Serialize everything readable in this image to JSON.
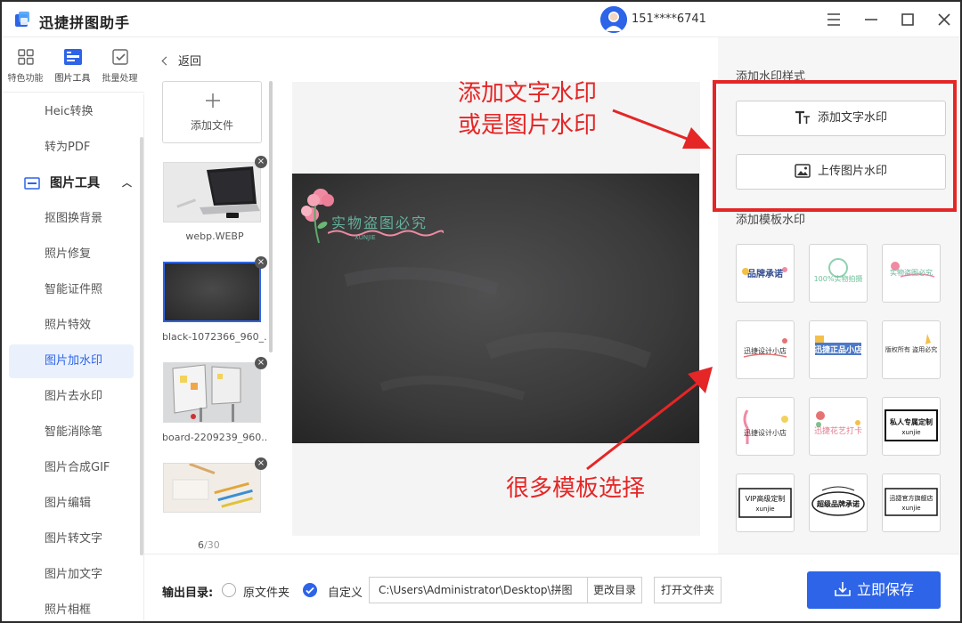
{
  "app": {
    "title": "迅捷拼图助手",
    "user_phone": "151****6741"
  },
  "top_tabs": [
    {
      "label": "特色功能",
      "icon": "grid-icon"
    },
    {
      "label": "图片工具",
      "icon": "image-tool-icon",
      "active": true
    },
    {
      "label": "批量处理",
      "icon": "batch-icon"
    }
  ],
  "sidebar": {
    "items_above": [
      "Heic转换",
      "转为PDF"
    ],
    "group": {
      "label": "图片工具"
    },
    "items": [
      "抠图换背景",
      "照片修复",
      "智能证件照",
      "照片特效",
      "图片加水印",
      "图片去水印",
      "智能消除笔",
      "图片合成GIF",
      "图片编辑",
      "图片转文字",
      "图片加文字",
      "照片相框"
    ],
    "active_item": "图片加水印"
  },
  "back_label": "返回",
  "files": {
    "add_label": "添加文件",
    "items": [
      {
        "name": "webp.WEBP"
      },
      {
        "name": "black-1072366_960_..."
      },
      {
        "name": "board-2209239_960..."
      }
    ],
    "page_current": "6",
    "page_total": "/30"
  },
  "preview": {
    "watermark_text": "实物盗图必究",
    "watermark_sub": "XUNJIE"
  },
  "right_panel": {
    "style_title": "添加水印样式",
    "add_text_label": "添加文字水印",
    "upload_image_label": "上传图片水印",
    "template_title": "添加模板水印",
    "templates": [
      {
        "text": "品牌承诺"
      },
      {
        "text": "100%实物拍摄"
      },
      {
        "text": "实物盗图必究"
      },
      {
        "text": "迅捷设计小店"
      },
      {
        "text": "迅捷正品小店"
      },
      {
        "text": "版权所有 盗用必究"
      },
      {
        "text": "迅捷设计小店"
      },
      {
        "text": "迅捷花艺打卡"
      },
      {
        "text": "私人专属定制",
        "sub": "xunjie"
      },
      {
        "text": "VIP高级定制",
        "sub": "xunjie"
      },
      {
        "text": "超级品牌承诺"
      },
      {
        "text": "迅捷官方旗舰店",
        "sub": "xunjie"
      }
    ]
  },
  "annotations": {
    "top_line1": "添加文字水印",
    "top_line2": "或是图片水印",
    "bottom": "很多模板选择"
  },
  "output": {
    "label": "输出目录:",
    "option_original": "原文件夹",
    "option_custom": "自定义",
    "path": "C:\\Users\\Administrator\\Desktop\\拼图",
    "change_dir": "更改目录",
    "open_folder": "打开文件夹",
    "save": "立即保存"
  },
  "colors": {
    "accent": "#2d64e8",
    "annotation": "#e52626",
    "board": "#3b3b3c"
  }
}
